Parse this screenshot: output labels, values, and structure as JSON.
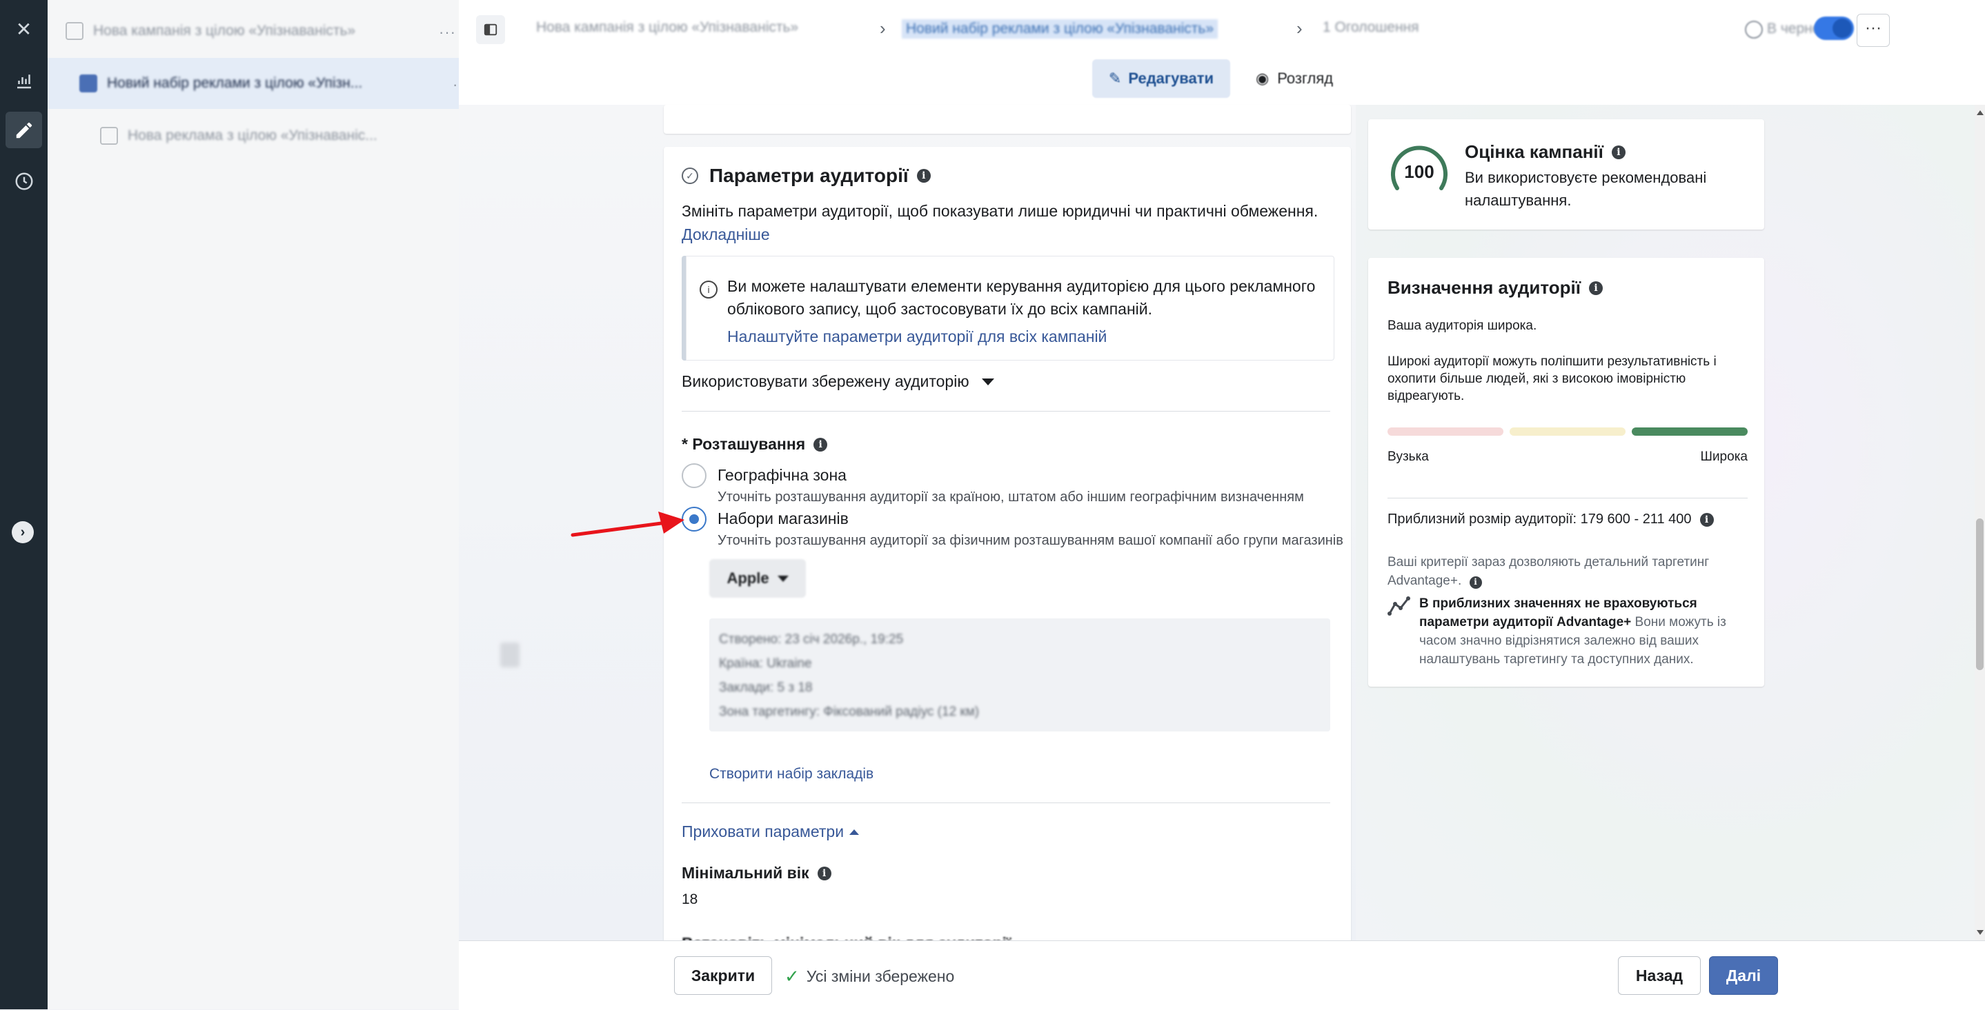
{
  "tree": {
    "items": [
      {
        "label": "Нова кампанія з цілою «Упізнаваність»",
        "more": "···"
      },
      {
        "label": "Новий набір реклами з цілою «Упізн...",
        "more": "···"
      },
      {
        "label": "Нова реклама з цілою «Упізнаваніс...",
        "more": "···"
      }
    ]
  },
  "topbar": {
    "crumbs": [
      "Нова кампанія з цілою «Упізнаваність»",
      "Новий набір реклами з цілою «Упізнаваність»",
      "1 Оголошення"
    ],
    "status": "В чернетці",
    "more": "···"
  },
  "modes": {
    "edit": "Редагувати",
    "view": "Розгляд"
  },
  "audience_settings": {
    "title": "Параметри аудиторії",
    "desc": "Змініть параметри аудиторії, щоб показувати лише юридичні чи практичні обмеження.",
    "learn_more": "Докладніше",
    "notice_text": "Ви можете налаштувати елементи керування аудиторією для цього рекламного облікового запису, щоб застосовувати їх до всіх кампаній.",
    "notice_link": "Налаштуйте параметри аудиторії для всіх кампаній",
    "saved_audience": "Використовувати збережену аудиторію",
    "location_label": "* Розташування",
    "options": [
      {
        "title": "Географічна зона",
        "desc": "Уточніть розташування аудиторії за країною, штатом або іншим географічним визначенням",
        "selected": false
      },
      {
        "title": "Набори магазинів",
        "desc": "Уточніть розташування аудиторії за фізичним розташуванням вашої компанії або групи магазинів",
        "selected": true
      }
    ],
    "store_set": "Apple",
    "store_details": [
      "Створено: 23 січ 2026р., 19:25",
      "Країна: Ukraine",
      "Заклади: 5 з 18",
      "Зона таргетингу: Фіксований радіус (12 км)"
    ],
    "create_set": "Створити набір закладів",
    "hide_params": "Приховати параметри",
    "min_age_label": "Мінімальний вік",
    "min_age_value": "18",
    "cut_label": "Встановіть мінімальний вік для аудиторії"
  },
  "score": {
    "value": "100",
    "title": "Оцінка кампанії",
    "desc": "Ви використовуєте рекомендовані налаштування."
  },
  "audience_def": {
    "title": "Визначення аудиторії",
    "broad": "Ваша аудиторія широка.",
    "broad_desc": "Широкі аудиторії можуть поліпшити результативність і охопити більше людей, які з високою імовірністю відреагують.",
    "narrow": "Вузька",
    "wide": "Широка",
    "size": "Приблизний розмір аудиторії: 179 600 - 211 400",
    "advantage_text": "Ваші критерії зараз дозволяють детальний таргетинг Advantage+.",
    "note_bold": "В приблизних значеннях не враховуються параметри аудиторії Advantage+",
    "note_rest": " Вони можуть із часом значно відрізнятися залежно від ваших налаштувань таргетингу та доступних даних."
  },
  "footer": {
    "close": "Закрити",
    "saved": "Усі зміни збережено",
    "back": "Назад",
    "next": "Далі"
  },
  "colors": {
    "accent": "#4a6fb5",
    "link": "#385898",
    "annotation_arrow": "#e8141b",
    "rail": "#1f2a33"
  }
}
